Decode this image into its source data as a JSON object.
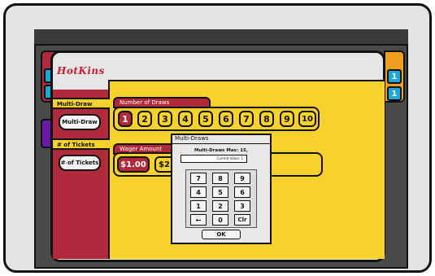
{
  "app": {
    "logo_text": "HotKins"
  },
  "sidebar": {
    "multi_draw_tab": "Multi-Draw",
    "multi_draw_button": "Multi-Draw",
    "tickets_tab": "# of Tickets",
    "tickets_button": "# of Tickets"
  },
  "draws": {
    "label": "Number of Draws",
    "options": [
      "1",
      "2",
      "3",
      "4",
      "5",
      "6",
      "7",
      "8",
      "9",
      "10"
    ],
    "selected": "1"
  },
  "wager": {
    "label": "Wager Amount",
    "options": [
      "$1.00",
      "$2."
    ],
    "selected": "$1.00"
  },
  "dialog": {
    "title": "Multi-Draws",
    "max_text": "Multi-Draws Max: 15,",
    "current_value": "Current Value: 1",
    "keys": [
      "7",
      "8",
      "9",
      "4",
      "5",
      "6",
      "1",
      "2",
      "3",
      "←",
      "0",
      "Clr"
    ],
    "ok_label": "OK"
  },
  "background_windows": {
    "right_buttons": [
      "1",
      "1"
    ]
  },
  "colors": {
    "accent_red": "#b02a3c",
    "panel_yellow": "#f7d22a",
    "stub_blue": "#1aa8d8",
    "stub_orange": "#f0a020",
    "stub_purple": "#6a1aa8"
  }
}
